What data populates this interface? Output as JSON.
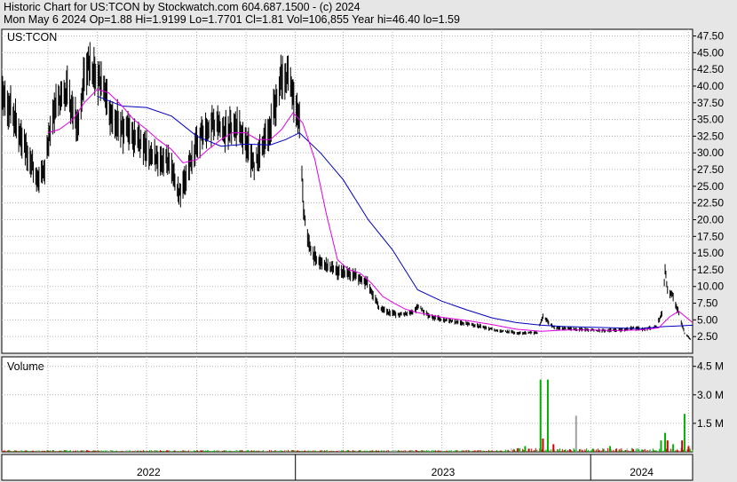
{
  "header": {
    "line1": "Historic Chart for US:TCON by Stockwatch.com 604.687.1500 - (c) 2024",
    "line2": "Mon May  6 2024   Op=1.88   Hi=1.9199   Lo=1.7701   Cl=1.81   Vol=106,855   Year hi=46.40   lo=1.59"
  },
  "colors": {
    "price_bars": "#000000",
    "ma_short": "#e000e0",
    "ma_long": "#0000c0",
    "volume_up": "#00b000",
    "volume_down": "#d00000",
    "volume_neutral": "#a0a0a0",
    "grid": "#b4b4b4",
    "panel_bg": "#ffffff",
    "page_bg": "#e6e6e6"
  },
  "chart_data": {
    "type": "line",
    "symbol_label": "US:TCON",
    "volume_panel_label": "Volume",
    "x_axis": {
      "labels": [
        "2022",
        "2023",
        "2024"
      ],
      "range": [
        "2022-01-03",
        "2024-05-06"
      ],
      "year_boundaries": [
        "2023-01-01",
        "2024-01-01"
      ]
    },
    "price_axis": {
      "ylim": [
        0,
        48.5
      ],
      "ticks": [
        2.5,
        5,
        7.5,
        10,
        12.5,
        15,
        17.5,
        20,
        22.5,
        25,
        27.5,
        30,
        32.5,
        35,
        37.5,
        40,
        42.5,
        45,
        47.5
      ],
      "tick_labels": [
        "2.50",
        "5.00",
        "7.50",
        "10.00",
        "12.50",
        "15.00",
        "17.50",
        "20.00",
        "22.50",
        "25.00",
        "27.50",
        "30.00",
        "32.50",
        "35.00",
        "37.50",
        "40.00",
        "42.50",
        "45.00",
        "47.50"
      ],
      "grid": true
    },
    "volume_axis": {
      "ylim": [
        0,
        5000000
      ],
      "ticks": [
        1500000,
        3000000,
        4500000
      ],
      "tick_labels": [
        "1.5 M",
        "3.0 M",
        "4.5 M"
      ],
      "grid": true
    },
    "price_series": {
      "name": "",
      "points": [
        [
          "2022-01-03",
          38.0
        ],
        [
          "2022-01-14",
          36.5
        ],
        [
          "2022-01-28",
          32.0
        ],
        [
          "2022-02-07",
          29.0
        ],
        [
          "2022-02-18",
          26.0
        ],
        [
          "2022-02-25",
          27.5
        ],
        [
          "2022-03-04",
          33.5
        ],
        [
          "2022-03-11",
          37.0
        ],
        [
          "2022-03-25",
          39.0
        ],
        [
          "2022-04-01",
          36.0
        ],
        [
          "2022-04-08",
          34.0
        ],
        [
          "2022-04-14",
          40.5
        ],
        [
          "2022-04-22",
          44.0
        ],
        [
          "2022-04-29",
          41.5
        ],
        [
          "2022-05-06",
          40.0
        ],
        [
          "2022-05-13",
          38.0
        ],
        [
          "2022-05-20",
          35.0
        ],
        [
          "2022-06-03",
          33.5
        ],
        [
          "2022-06-17",
          32.0
        ],
        [
          "2022-07-01",
          30.5
        ],
        [
          "2022-07-15",
          29.0
        ],
        [
          "2022-07-29",
          28.5
        ],
        [
          "2022-08-05",
          26.0
        ],
        [
          "2022-08-12",
          23.5
        ],
        [
          "2022-08-19",
          26.5
        ],
        [
          "2022-08-26",
          29.5
        ],
        [
          "2022-09-02",
          31.5
        ],
        [
          "2022-09-09",
          33.5
        ],
        [
          "2022-09-23",
          34.5
        ],
        [
          "2022-10-07",
          33.5
        ],
        [
          "2022-10-21",
          34.0
        ],
        [
          "2022-11-04",
          30.5
        ],
        [
          "2022-11-11",
          28.0
        ],
        [
          "2022-11-18",
          30.5
        ],
        [
          "2022-11-25",
          32.0
        ],
        [
          "2022-12-02",
          34.5
        ],
        [
          "2022-12-09",
          38.5
        ],
        [
          "2022-12-16",
          42.5
        ],
        [
          "2022-12-23",
          41.0
        ],
        [
          "2022-12-30",
          38.0
        ],
        [
          "2023-01-06",
          35.5
        ],
        [
          "2023-01-11",
          21.0
        ],
        [
          "2023-01-20",
          15.0
        ],
        [
          "2023-02-03",
          13.5
        ],
        [
          "2023-02-17",
          12.5
        ],
        [
          "2023-03-03",
          12.0
        ],
        [
          "2023-03-17",
          11.5
        ],
        [
          "2023-03-31",
          10.5
        ],
        [
          "2023-04-14",
          7.0
        ],
        [
          "2023-04-28",
          6.0
        ],
        [
          "2023-05-12",
          5.8
        ],
        [
          "2023-05-26",
          6.2
        ],
        [
          "2023-06-02",
          7.0
        ],
        [
          "2023-06-16",
          5.5
        ],
        [
          "2023-07-14",
          4.8
        ],
        [
          "2023-08-11",
          4.2
        ],
        [
          "2023-09-08",
          3.4
        ],
        [
          "2023-10-06",
          3.0
        ],
        [
          "2023-10-27",
          3.1
        ],
        [
          "2023-11-03",
          5.5
        ],
        [
          "2023-11-17",
          3.8
        ],
        [
          "2023-12-15",
          3.6
        ],
        [
          "2024-01-12",
          3.4
        ],
        [
          "2024-02-09",
          3.5
        ],
        [
          "2024-02-23",
          3.8
        ],
        [
          "2024-03-08",
          3.6
        ],
        [
          "2024-03-22",
          4.0
        ],
        [
          "2024-03-29",
          6.0
        ],
        [
          "2024-04-02",
          12.5
        ],
        [
          "2024-04-05",
          9.5
        ],
        [
          "2024-04-12",
          8.5
        ],
        [
          "2024-04-19",
          6.0
        ],
        [
          "2024-04-26",
          3.0
        ],
        [
          "2024-05-06",
          1.81
        ]
      ]
    },
    "ma_short_series": {
      "name": "",
      "points": [
        [
          "2022-03-01",
          33.0
        ],
        [
          "2022-03-15",
          33.5
        ],
        [
          "2022-04-01",
          35.0
        ],
        [
          "2022-04-15",
          37.5
        ],
        [
          "2022-05-01",
          39.5
        ],
        [
          "2022-05-15",
          39.0
        ],
        [
          "2022-06-01",
          37.0
        ],
        [
          "2022-06-15",
          35.0
        ],
        [
          "2022-07-01",
          33.5
        ],
        [
          "2022-07-15",
          32.0
        ],
        [
          "2022-08-01",
          30.5
        ],
        [
          "2022-08-15",
          28.5
        ],
        [
          "2022-09-01",
          29.0
        ],
        [
          "2022-09-15",
          30.5
        ],
        [
          "2022-10-01",
          32.0
        ],
        [
          "2022-10-15",
          33.0
        ],
        [
          "2022-11-01",
          33.0
        ],
        [
          "2022-11-15",
          32.0
        ],
        [
          "2022-12-01",
          32.0
        ],
        [
          "2022-12-15",
          33.5
        ],
        [
          "2022-12-29",
          36.0
        ],
        [
          "2023-01-10",
          34.5
        ],
        [
          "2023-01-25",
          29.0
        ],
        [
          "2023-02-08",
          21.0
        ],
        [
          "2023-02-22",
          14.0
        ],
        [
          "2023-03-08",
          12.5
        ],
        [
          "2023-03-22",
          12.0
        ],
        [
          "2023-04-05",
          10.5
        ],
        [
          "2023-04-19",
          8.5
        ],
        [
          "2023-05-03",
          7.5
        ],
        [
          "2023-05-17",
          6.6
        ],
        [
          "2023-06-01",
          6.1
        ],
        [
          "2023-07-01",
          5.4
        ],
        [
          "2023-08-01",
          4.9
        ],
        [
          "2023-09-01",
          4.3
        ],
        [
          "2023-10-01",
          3.6
        ],
        [
          "2023-11-01",
          3.3
        ],
        [
          "2023-12-01",
          3.5
        ],
        [
          "2024-01-01",
          3.5
        ],
        [
          "2024-02-01",
          3.4
        ],
        [
          "2024-03-01",
          3.5
        ],
        [
          "2024-03-25",
          3.8
        ],
        [
          "2024-04-08",
          5.5
        ],
        [
          "2024-04-19",
          6.3
        ],
        [
          "2024-05-06",
          4.6
        ]
      ]
    },
    "ma_long_series": {
      "name": "",
      "points": [
        [
          "2022-05-01",
          38.5
        ],
        [
          "2022-06-01",
          37.0
        ],
        [
          "2022-07-01",
          36.8
        ],
        [
          "2022-08-01",
          35.5
        ],
        [
          "2022-09-01",
          32.5
        ],
        [
          "2022-10-01",
          31.0
        ],
        [
          "2022-11-01",
          31.3
        ],
        [
          "2022-12-01",
          31.2
        ],
        [
          "2022-12-20",
          32.0
        ],
        [
          "2023-01-06",
          33.0
        ],
        [
          "2023-02-01",
          30.0
        ],
        [
          "2023-03-01",
          26.0
        ],
        [
          "2023-04-01",
          20.0
        ],
        [
          "2023-05-01",
          15.5
        ],
        [
          "2023-06-01",
          9.5
        ],
        [
          "2023-07-01",
          7.8
        ],
        [
          "2023-08-01",
          6.5
        ],
        [
          "2023-09-01",
          5.3
        ],
        [
          "2023-10-01",
          4.6
        ],
        [
          "2023-11-01",
          4.2
        ],
        [
          "2023-12-01",
          4.0
        ],
        [
          "2024-01-01",
          3.9
        ],
        [
          "2024-02-01",
          3.8
        ],
        [
          "2024-03-01",
          3.7
        ],
        [
          "2024-04-01",
          4.0
        ],
        [
          "2024-05-06",
          4.2
        ]
      ]
    },
    "volume_spikes": [
      {
        "date": "2023-10-12",
        "volume": 300000,
        "dir": "up"
      },
      {
        "date": "2023-10-31",
        "volume": 3800000,
        "dir": "up"
      },
      {
        "date": "2023-11-03",
        "volume": 700000,
        "dir": "down"
      },
      {
        "date": "2023-11-09",
        "volume": 3800000,
        "dir": "up"
      },
      {
        "date": "2023-11-16",
        "volume": 400000,
        "dir": "down"
      },
      {
        "date": "2023-12-14",
        "volume": 1900000,
        "dir": "neutral"
      },
      {
        "date": "2024-01-25",
        "volume": 300000,
        "dir": "up"
      },
      {
        "date": "2024-03-28",
        "volume": 600000,
        "dir": "up"
      },
      {
        "date": "2024-04-02",
        "volume": 1000000,
        "dir": "up"
      },
      {
        "date": "2024-04-05",
        "volume": 600000,
        "dir": "down"
      },
      {
        "date": "2024-04-12",
        "volume": 400000,
        "dir": "up"
      },
      {
        "date": "2024-04-23",
        "volume": 600000,
        "dir": "down"
      },
      {
        "date": "2024-04-26",
        "volume": 2000000,
        "dir": "up"
      },
      {
        "date": "2024-05-01",
        "volume": 300000,
        "dir": "down"
      }
    ],
    "volume_baseline": 80000
  }
}
